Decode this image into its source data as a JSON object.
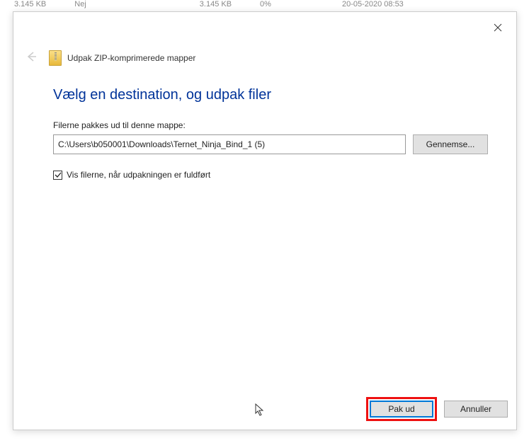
{
  "background": {
    "size": "3.145 KB",
    "nej": "Nej",
    "size2": "3.145 KB",
    "pct": "0%",
    "date": "20-05-2020 08:53"
  },
  "dialog": {
    "window_title": "Udpak ZIP-komprimerede mapper",
    "heading": "Vælg en destination, og udpak filer",
    "field_label": "Filerne pakkes ud til denne mappe:",
    "path_value": "C:\\Users\\b050001\\Downloads\\Ternet_Ninja_Bind_1 (5)",
    "browse_label": "Gennemse...",
    "checkbox_label": "Vis filerne, når udpakningen er fuldført",
    "checkbox_checked": true,
    "extract_label": "Pak ud",
    "cancel_label": "Annuller"
  }
}
